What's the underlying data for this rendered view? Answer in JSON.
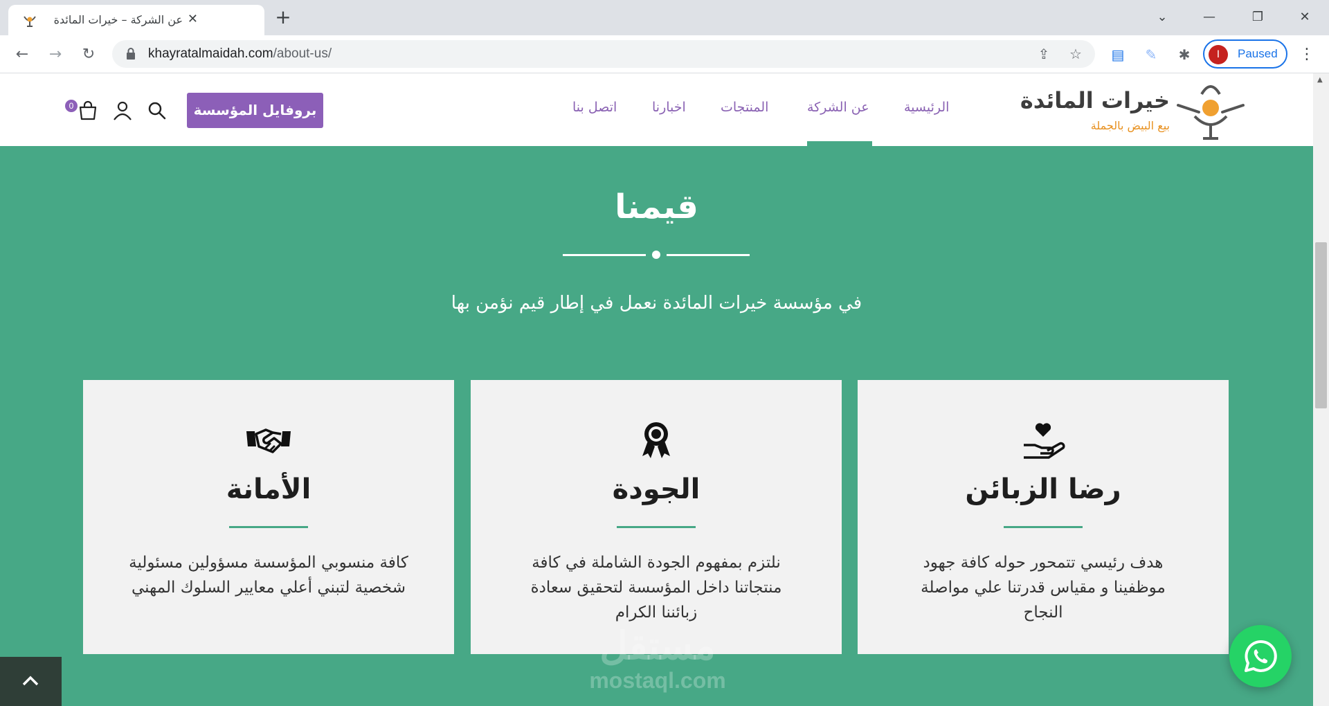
{
  "browser": {
    "tab_title": "عن الشركة – خيرات المائدة",
    "url_domain": "khayratalmaidah.com",
    "url_path": "/about-us/",
    "profile_initial": "I",
    "profile_label": "Paused"
  },
  "header": {
    "logo_name": "خيرات المائدة",
    "logo_tagline": "بيع البيض بالجملة",
    "nav": [
      {
        "label": "الرئيسية"
      },
      {
        "label": "عن الشركة"
      },
      {
        "label": "المنتجات"
      },
      {
        "label": "اخبارنا"
      },
      {
        "label": "اتصل بنا"
      }
    ],
    "active_nav": "عن الشركة",
    "profile_button": "بروفايل المؤسسة",
    "cart_count": "0",
    "icons": [
      "search-icon",
      "user-icon",
      "cart-icon"
    ]
  },
  "values": {
    "title": "قيمنا",
    "subtitle": "في مؤسسة خيرات المائدة نعمل في إطار قيم نؤمن بها",
    "cards": [
      {
        "icon": "hand-heart-icon",
        "title": "رضا الزبائن",
        "text": "هدف رئيسي تتمحور حوله كافة جهود موظفينا و مقياس قدرتنا علي مواصلة النجاح"
      },
      {
        "icon": "award-ribbon-icon",
        "title": "الجودة",
        "text": "نلتزم بمفهوم الجودة الشاملة في كافة منتجاتنا داخل المؤسسة لتحقيق سعادة زبائننا الكرام"
      },
      {
        "icon": "handshake-icon",
        "title": "الأمانة",
        "text": "كافة منسوبي المؤسسة مسؤولين مسئولية شخصية لتبني أعلي معايير السلوك المهني"
      }
    ]
  },
  "watermark": {
    "arabic": "مستقل",
    "latin": "mostaql.com"
  },
  "colors": {
    "section_bg": "#47a886",
    "accent_purple": "#8c5fb8",
    "nav_text": "#8a62b3",
    "logo_orange": "#e8901e"
  }
}
